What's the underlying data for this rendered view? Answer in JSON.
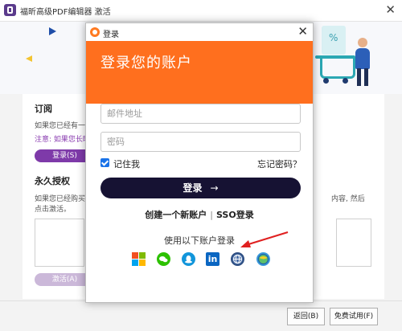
{
  "background_window": {
    "title": "福昕高级PDF编辑器 激活",
    "close_glyph": "✕",
    "subscription": {
      "title": "订阅",
      "desc": "如果您已经有一个",
      "note": "注意: 如果您长时",
      "login_button": "登录(S)"
    },
    "perpetual": {
      "title": "永久授权",
      "desc_line1": "如果您已经购买",
      "desc_right": "内容, 然后",
      "desc_line2": "点击激活。",
      "activate_button": "激活(A)"
    },
    "footer": {
      "back_button": "返回(B)",
      "trial_button": "免费试用(F)"
    }
  },
  "login_dialog": {
    "title": "登录",
    "close_glyph": "✕",
    "heading": "登录您的账户",
    "email_placeholder": "邮件地址",
    "password_placeholder": "密码",
    "remember_me": "记住我",
    "forgot_password": "忘记密码？",
    "login_button": "登录",
    "login_arrow": "→",
    "create_account": "创建一个新账户",
    "link_separator": "|",
    "sso_login": "SSO登录",
    "alt_login_label": "使用以下账户登录",
    "linkedin_glyph": "in",
    "social_providers": [
      "microsoft-icon",
      "wechat-icon",
      "qq-icon",
      "linkedin-icon",
      "web-icon",
      "sso-globe-icon"
    ],
    "colors": {
      "header": "#ff6f1e",
      "login_button": "#161233",
      "checkbox": "#1a73e8",
      "annotation_arrow": "#e02020"
    }
  }
}
